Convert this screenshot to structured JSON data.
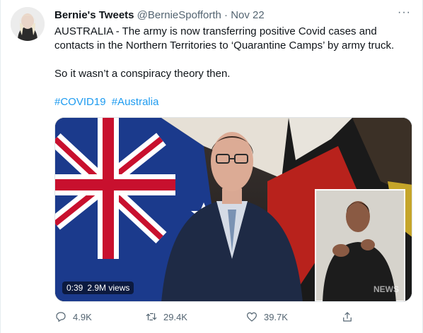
{
  "tweet": {
    "display_name": "Bernie's Tweets",
    "handle": "@BernieSpofforth",
    "separator": "·",
    "date": "Nov 22",
    "more_label": "···",
    "text_line1": "AUSTRALIA - The army is now transferring positive Covid cases and contacts in the Northern Territories to ‘Quarantine Camps’ by army truck.",
    "text_line2": "So it wasn’t a conspiracy theory then.",
    "hashtags": [
      "#COVID19",
      "#Australia"
    ]
  },
  "media": {
    "duration": "0:39",
    "views": "2.9M views",
    "watermark": "NEWS"
  },
  "actions": {
    "reply_count": "4.9K",
    "retweet_count": "29.4K",
    "like_count": "39.7K",
    "reply_icon": "reply-icon",
    "retweet_icon": "retweet-icon",
    "like_icon": "heart-icon",
    "share_icon": "share-icon"
  },
  "colors": {
    "link": "#1d9bf0",
    "muted": "#536471",
    "text": "#0f1419"
  }
}
